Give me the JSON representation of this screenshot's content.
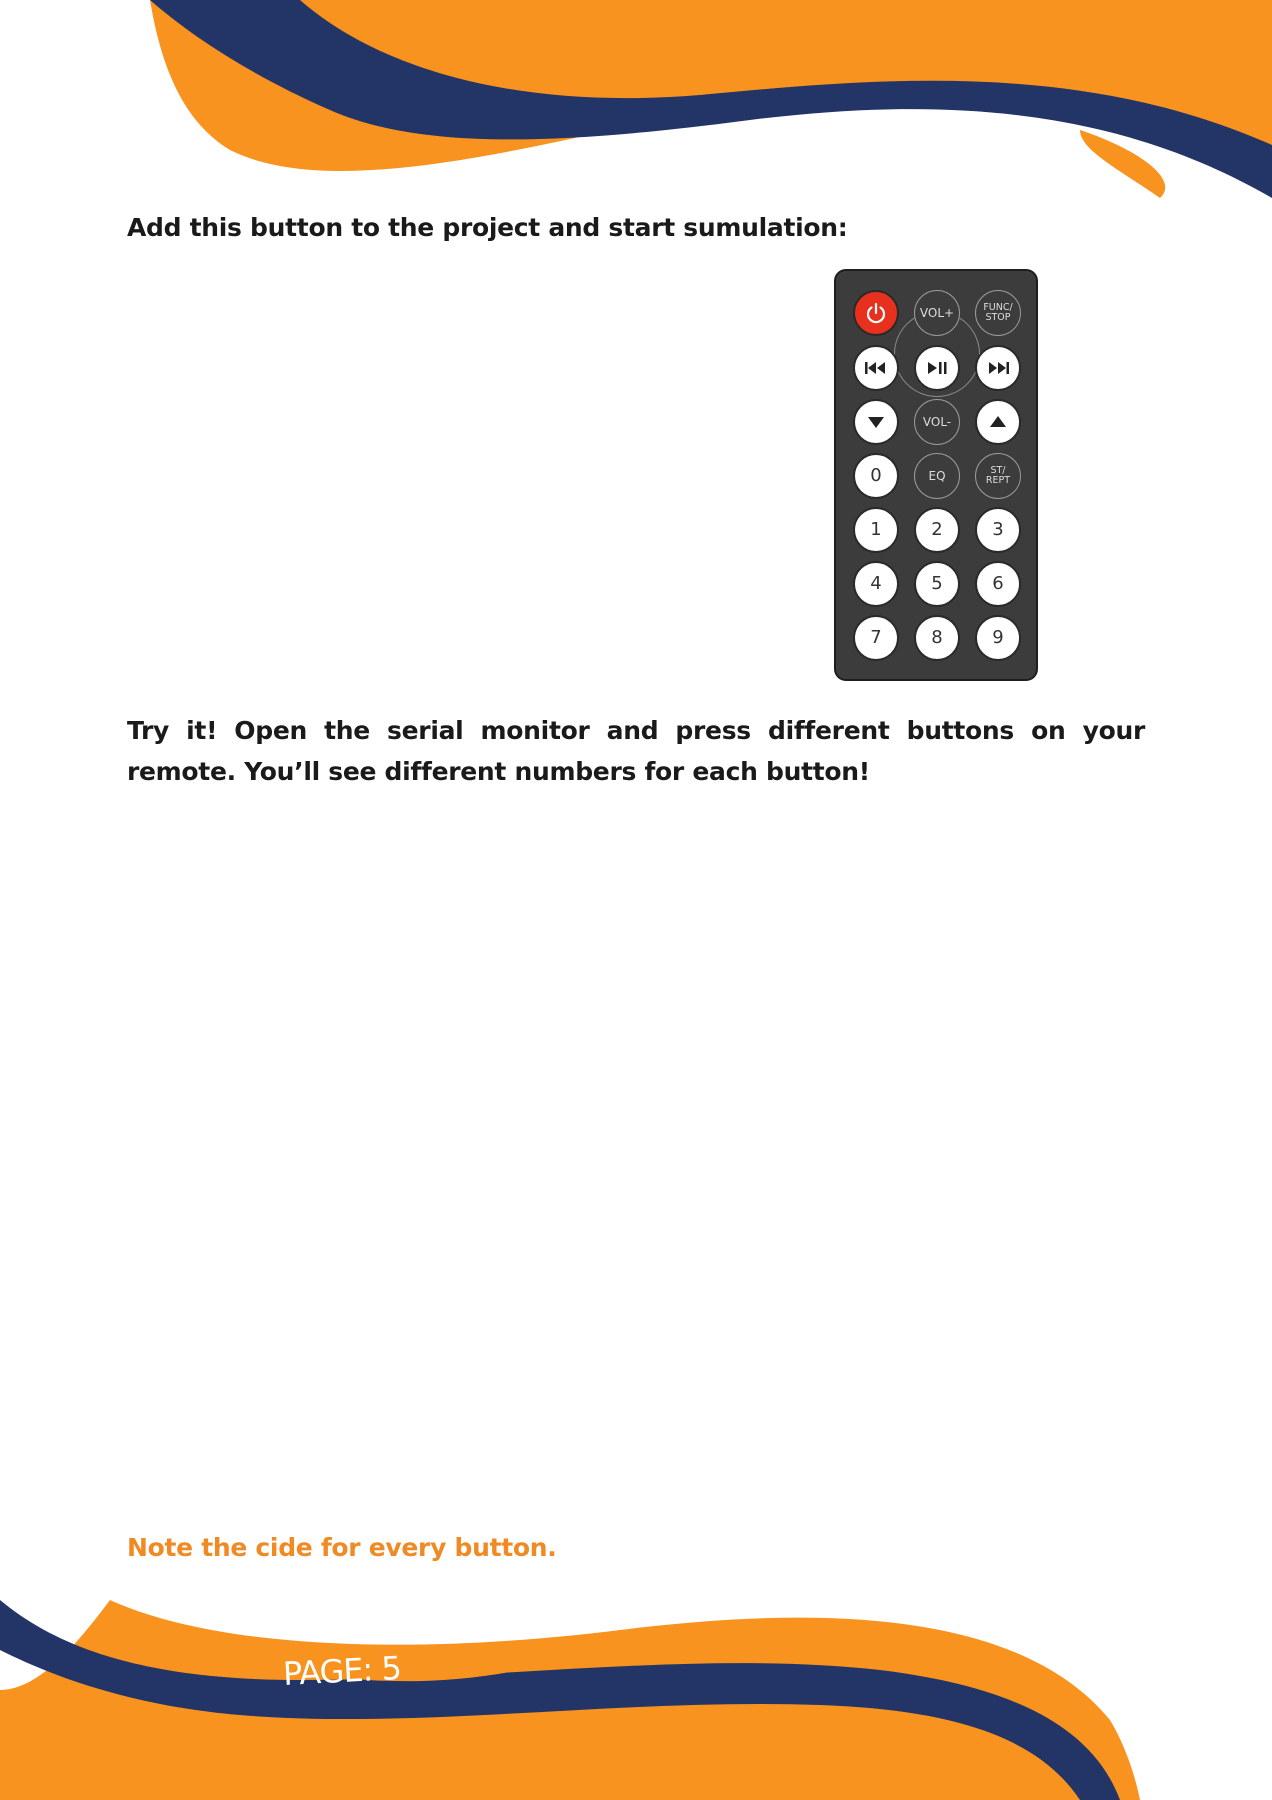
{
  "intro_text": "Add this button to the project and start sumulation:",
  "body_text_line1": "Try it! Open the serial monitor and press different buttons on your remote.",
  "body_text_line2": "You’ll see different numbers for each button!",
  "note_text": "Note the cide for every button.",
  "page_label": "PAGE: 5",
  "colors": {
    "orange": "#f7931e",
    "navy": "#233566",
    "note_orange": "#f08a24",
    "power_red": "#e8301e"
  },
  "remote": {
    "buttons": {
      "power": "power-icon",
      "vol_up": "VOL+",
      "func_stop": "FUNC/\nSTOP",
      "prev": "previous-track-icon",
      "play_pause": "play-pause-icon",
      "next": "next-track-icon",
      "down": "down-arrow-icon",
      "vol_down": "VOL-",
      "up": "up-arrow-icon",
      "zero": "0",
      "eq": "EQ",
      "st_rept": "ST/\nREPT",
      "one": "1",
      "two": "2",
      "three": "3",
      "four": "4",
      "five": "5",
      "six": "6",
      "seven": "7",
      "eight": "8",
      "nine": "9"
    }
  }
}
